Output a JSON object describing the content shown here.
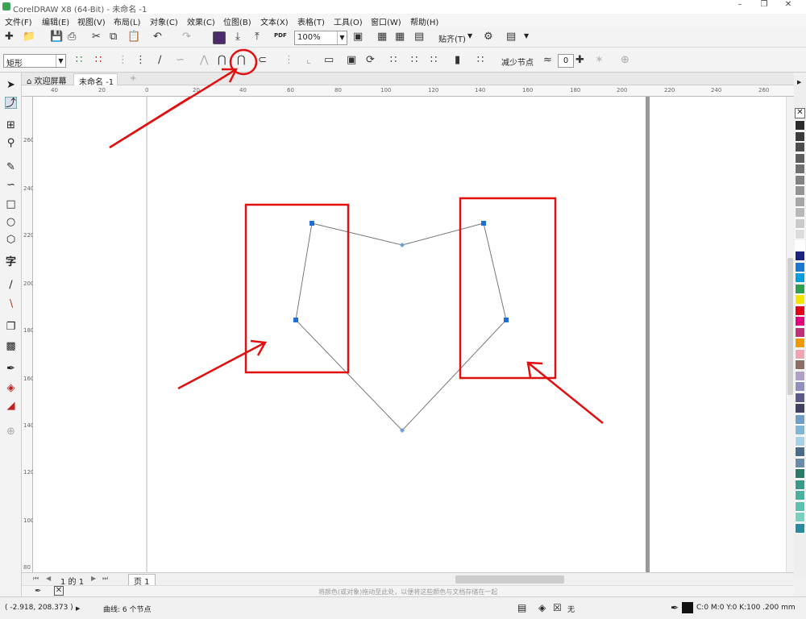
{
  "window": {
    "title": "CorelDRAW X8 (64-Bit) - 未命名 -1",
    "minimize": "–",
    "restore": "❐",
    "close": "✕"
  },
  "menu": [
    "文件(F)",
    "编辑(E)",
    "视图(V)",
    "布局(L)",
    "对象(C)",
    "效果(C)",
    "位图(B)",
    "文本(X)",
    "表格(T)",
    "工具(O)",
    "窗口(W)",
    "帮助(H)"
  ],
  "toolbar": {
    "zoom": "100%",
    "snap_label": "贴齐(T)",
    "pdf_label": "PDF"
  },
  "property_bar": {
    "shape_type": "矩形",
    "reduce_nodes_label": "减少节点",
    "smoothness": "0"
  },
  "tabs": {
    "welcome": "欢迎屏幕",
    "document": "未命名 -1",
    "add": "+"
  },
  "ruler_h": [
    "40",
    "20",
    "0",
    "20",
    "40",
    "60",
    "80",
    "100",
    "120",
    "140",
    "160",
    "180",
    "200",
    "220",
    "240",
    "260"
  ],
  "ruler_v": [
    "260",
    "240",
    "220",
    "200",
    "180",
    "160",
    "140",
    "120",
    "100",
    "80"
  ],
  "page_nav": {
    "page_counter": "1 的 1",
    "page_tab": "页 1"
  },
  "hint_text": "将颜色(或对象)拖动至此处，以便将这些颜色与文档存储在一起",
  "status": {
    "coordinates": "( -2.918, 208.373 )",
    "object_info": "曲线: 6 个节点",
    "fill_label": "无",
    "outline_info": "C:0 M:0 Y:0 K:100  .200 mm"
  },
  "palette_colors": [
    "#2b2b2b",
    "#3b3b3b",
    "#4d4d4d",
    "#5e5e5e",
    "#707070",
    "#828282",
    "#949494",
    "#a6a6a6",
    "#b8b8b8",
    "#cacaca",
    "#dcdcdc",
    "#ffffff",
    "#1a237e",
    "#1976d2",
    "#00a0e0",
    "#2e9e4f",
    "#f5e400",
    "#e3001b",
    "#e4007f",
    "#c0307a",
    "#f39800",
    "#f2a3b0",
    "#8d6e63",
    "#b0a0c8",
    "#9090c0",
    "#5a5a8a",
    "#404060",
    "#6e9ec8",
    "#7fb6d8",
    "#a8d0e8",
    "#4a6a8a",
    "#6a8aaa",
    "#2a7a6a",
    "#3a9a8a",
    "#4ab0a0",
    "#5ac0b0",
    "#7ad0c0",
    "#2a8aa0"
  ]
}
